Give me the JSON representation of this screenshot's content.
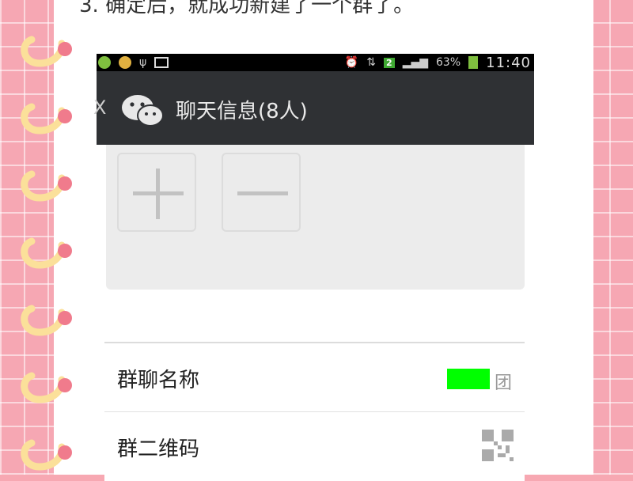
{
  "instruction": "3. 确定后，就成功新建了一个群了。",
  "status_bar": {
    "battery_percent": "63%",
    "network_badge": "2",
    "time": "11:40"
  },
  "chat": {
    "back_glyph": "X",
    "title": "聊天信息(8人)",
    "logo_icon": "wechat-icon"
  },
  "members": {
    "add_icon": "plus-icon",
    "remove_icon": "minus-icon"
  },
  "settings": [
    {
      "label": "群聊名称",
      "value": "团"
    },
    {
      "label": "群二维码",
      "icon": "qr-code-icon"
    }
  ],
  "colors": {
    "title_bar": "#2f3134",
    "panel": "#ececec",
    "highlight": "#00ff00",
    "background_pink": "#f6a7b3"
  }
}
